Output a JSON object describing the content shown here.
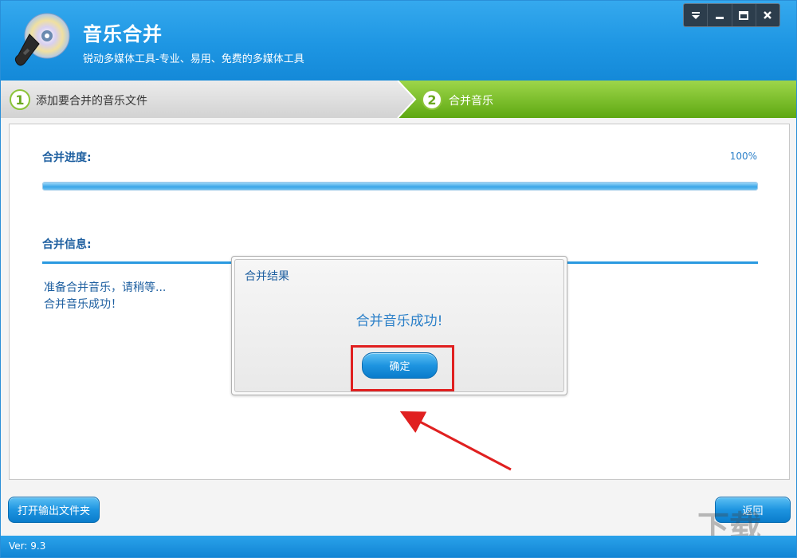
{
  "header": {
    "title": "音乐合并",
    "subtitle": "锐动多媒体工具-专业、易用、免费的多媒体工具",
    "logo_icon": "cd-disc-icon"
  },
  "window_controls": [
    "dropdown-menu-icon",
    "minimize-icon",
    "maximize-icon",
    "close-icon"
  ],
  "steps": [
    {
      "number": "1",
      "label": "添加要合并的音乐文件",
      "active": false
    },
    {
      "number": "2",
      "label": "合并音乐",
      "active": true
    }
  ],
  "progress": {
    "title": "合并进度:",
    "percent_text": "100%",
    "value": 100
  },
  "info": {
    "title": "合并信息:",
    "lines": [
      "准备合并音乐，请稍等...",
      "合并音乐成功！"
    ]
  },
  "dialog": {
    "title": "合并结果",
    "message": "合并音乐成功!",
    "ok_label": "确定"
  },
  "buttons": {
    "open_folder": "打开输出文件夹",
    "back": "返回"
  },
  "footer": {
    "version": "Ver: 9.3"
  },
  "colors": {
    "header_blue": "#1e96e3",
    "step_active_green": "#6fb41e",
    "highlight_red": "#e02020"
  }
}
